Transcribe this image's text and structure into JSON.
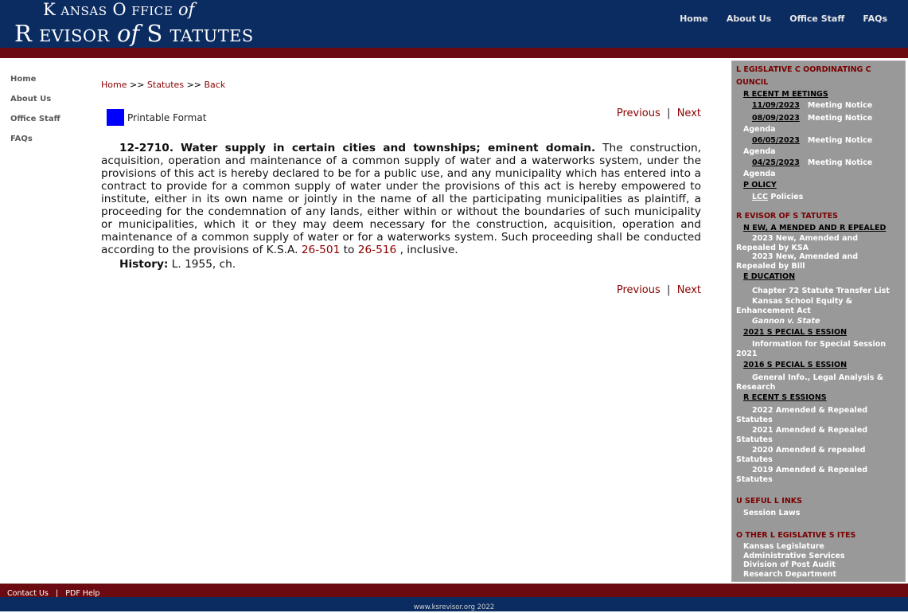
{
  "header": {
    "logo_line1_k": "K",
    "logo_line1_ansas": "ANSAS",
    "logo_line1_o": "O",
    "logo_line1_ffice": "FFICE",
    "logo_line1_of": "of",
    "logo_line2_r": "R",
    "logo_line2_evisor": "EVISOR",
    "logo_line2_of": "of",
    "logo_line2_s": "S",
    "logo_line2_tatutes": "TATUTES",
    "nav": [
      "Home",
      "About Us",
      "Office Staff",
      "FAQs"
    ]
  },
  "leftnav": [
    "Home",
    "About Us",
    "Office Staff",
    "FAQs"
  ],
  "breadcrumb": {
    "home": "Home",
    "sep1": ">>",
    "statutes": "Statutes",
    "sep2": ">>",
    "back": "Back"
  },
  "tools": {
    "printable": "Printable Format",
    "previous": "Previous",
    "separator": "|",
    "next": "Next"
  },
  "statute": {
    "section": "12-2710.",
    "title": "Water supply in certain cities and townships; eminent domain.",
    "body": "The construction, acquisition, operation and maintenance of a common supply of water and a waterworks system, under the provisions of this act is hereby declared to be for a public use, and any municipality which has entered into a contract to provide for a common supply of water under the provisions of this act is hereby empowered to institute, either in its own name or jointly in the name of all the participating municipalities as plaintiff, a proceeding for the condemnation of any lands, either within or without the boundaries of such municipality or municipalities, which it or they may deem necessary for the construction, acquisition, operation and maintenance of a common supply of water or for a waterworks system. Such proceeding shall be conducted according to the provisions of K.S.A.",
    "link1": "26-501",
    "to": "to",
    "link2": "26-516",
    "tail": ", inclusive.",
    "history_label": "History:",
    "history_text": "L. 1955, ch."
  },
  "rightpanel": {
    "lcc_head_1": "L EGISLATIVE C OORDINATING C",
    "lcc_head_2": "OUNCIL",
    "recent_meetings": "R ECENT M EETINGS",
    "meetings": [
      {
        "date": "11/09/2023",
        "label": "Meeting Notice"
      },
      {
        "date": "08/09/2023",
        "label": "Meeting Notice"
      },
      {
        "date": "",
        "label": "Agenda"
      },
      {
        "date": "06/05/2023",
        "label": "Meeting Notice"
      },
      {
        "date": "",
        "label": "Agenda"
      },
      {
        "date": "04/25/2023",
        "label": "Meeting Notice"
      },
      {
        "date": "",
        "label": "Agenda"
      }
    ],
    "policy": "P OLICY",
    "lcc_policies_lcc": "LCC",
    "lcc_policies": "Policies",
    "ros_head": "R EVISOR OF S TATUTES",
    "new_amended": "N EW, A MENDED AND R EPEALED",
    "na_links": [
      "2023 New, Amended and",
      "Repealed by KSA",
      "2023 New, Amended and",
      "Repealed by Bill"
    ],
    "education": "E DUCATION",
    "edu_links": [
      "Chapter 72 Statute Transfer List",
      "Kansas School Equity &",
      "Enhancement Act",
      "Gannon v. State"
    ],
    "ss2021": "2021 S PECIAL S ESSION",
    "ss2021_links": [
      "Information for Special Session",
      "2021"
    ],
    "ss2016": "2016 S PECIAL S ESSION",
    "ss2016_links": [
      "General Info., Legal Analysis &",
      "Research"
    ],
    "recent_sessions": "R ECENT S ESSIONS",
    "rs_links": [
      "2022 Amended & Repealed",
      "Statutes",
      "2021 Amended & Repealed",
      "Statutes",
      "2020 Amended & repealed",
      "Statutes",
      "2019 Amended & Repealed",
      "Statutes"
    ],
    "useful_head": "U SEFUL L INKS",
    "useful_links": [
      "Session Laws"
    ],
    "other_head": "O THER  L EGISLATIVE  S ITES",
    "other_links": [
      "Kansas Legislature",
      "Administrative Services",
      "Division of Post Audit",
      "Research Department"
    ]
  },
  "footer": {
    "contact": "Contact Us",
    "sep": "|",
    "pdf_help": "PDF Help",
    "copyright": "www.ksrevisor.org 2022"
  },
  "colors": {
    "header_blue": "#0b2c61",
    "band_red": "#6b0a10",
    "link_red": "#8b0000",
    "panel_grey": "#999999"
  }
}
